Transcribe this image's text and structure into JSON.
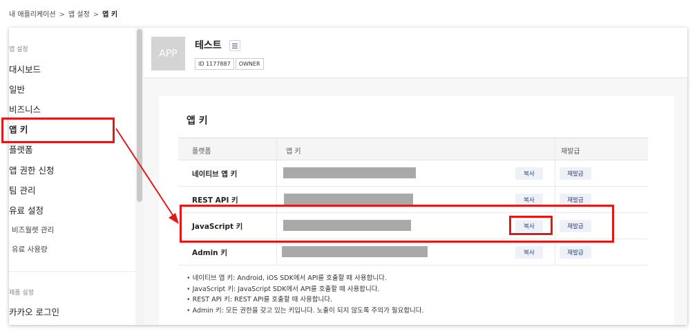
{
  "breadcrumb": {
    "items": [
      "내 애플리케이션",
      "앱 설정",
      "앱 키"
    ],
    "separator": ">"
  },
  "sidebar": {
    "section_app_settings": "앱 설정",
    "items": [
      "대시보드",
      "일반",
      "비즈니스",
      "앱 키",
      "플랫폼",
      "앱 권한 신청",
      "팀 관리",
      "유료 설정"
    ],
    "sub_items": [
      "비즈월렛 관리",
      "유료 사용량"
    ],
    "section_product_settings": "제품 설정",
    "product_items": [
      "카카오 로그인"
    ],
    "active_item": "앱 키"
  },
  "app": {
    "icon_text": "APP",
    "name": "테스트",
    "id_badge": "ID 1177887",
    "role_badge": "OWNER"
  },
  "app_keys": {
    "title": "앱 키",
    "columns": [
      "플랫폼",
      "앱 키",
      "재발급"
    ],
    "rows": [
      {
        "platform": "네이티브 앱 키",
        "copy_label": "복사",
        "reissue_label": "재발급"
      },
      {
        "platform": "REST API 키",
        "copy_label": "복사",
        "reissue_label": "재발급"
      },
      {
        "platform": "JavaScript 키",
        "copy_label": "복사",
        "reissue_label": "재발급"
      },
      {
        "platform": "Admin 키",
        "copy_label": "복사",
        "reissue_label": "재발급"
      }
    ],
    "notes": [
      "네이티브 앱 키: Android, iOS SDK에서 API를 호출할 때 사용합니다.",
      "JavaScript 키: JavaScript SDK에서 API를 호출할 때 사용합니다.",
      "REST API 키: REST API를 호출할 때 사용합니다.",
      "Admin 키: 모든 권한을 갖고 있는 키입니다. 노출이 되지 않도록 주의가 필요합니다."
    ]
  },
  "colors": {
    "highlight": "#e01818",
    "button_bg": "#eef1f7",
    "button_text": "#2b3f6b",
    "key_mask": "#a9a9a9"
  }
}
